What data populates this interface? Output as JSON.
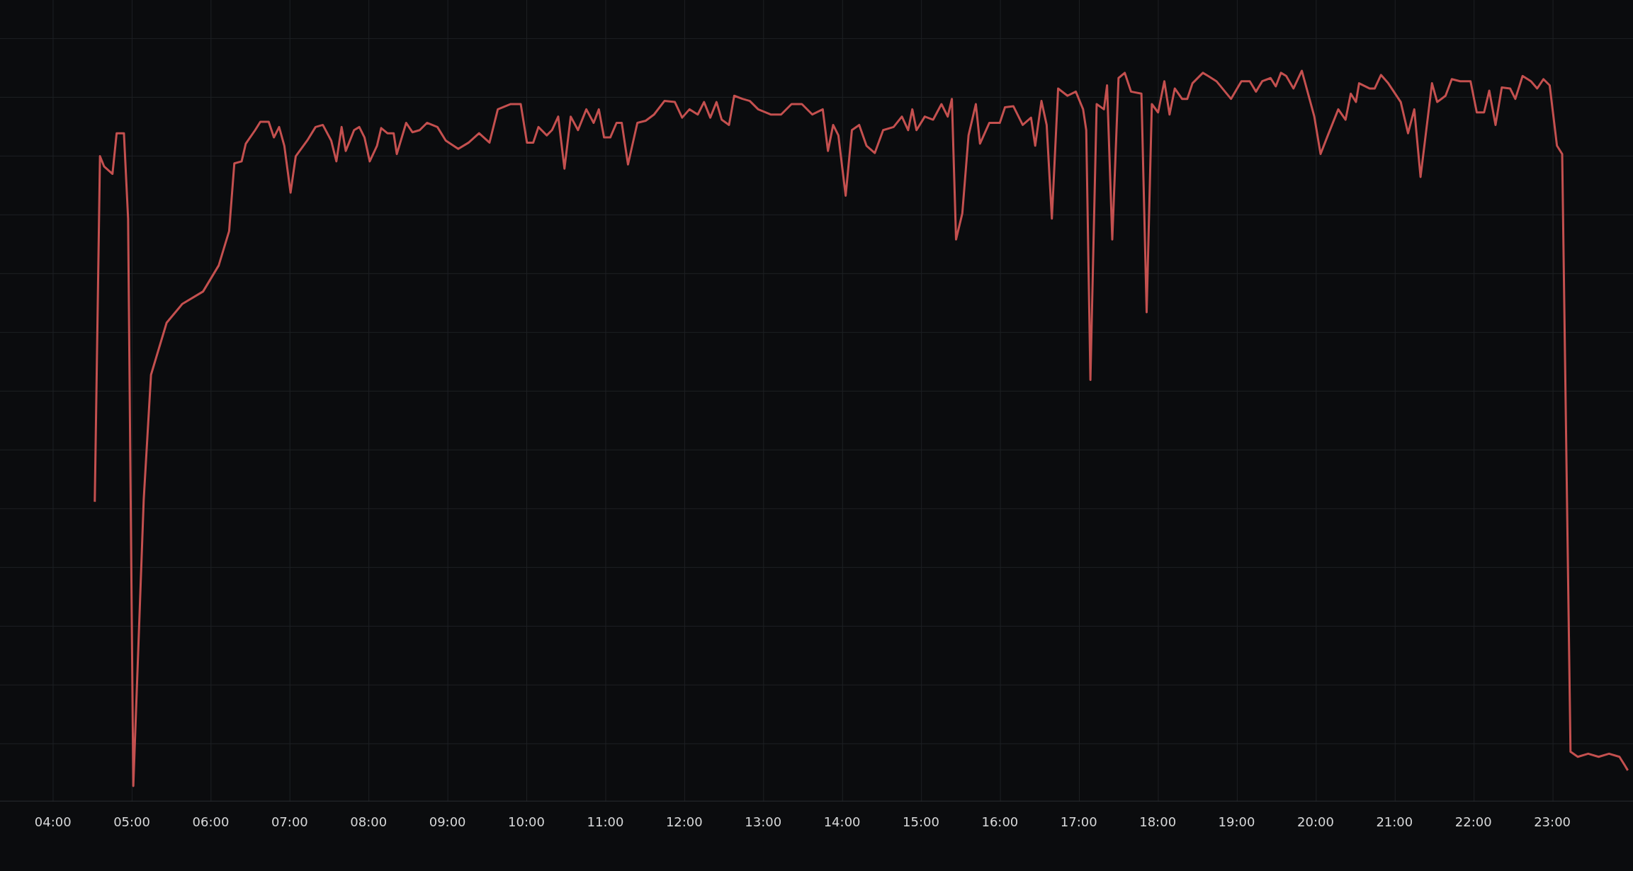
{
  "time_axis": {
    "labels": [
      "04:00",
      "05:00",
      "06:00",
      "07:00",
      "08:00",
      "09:00",
      "10:00",
      "11:00",
      "12:00",
      "13:00",
      "14:00",
      "15:00",
      "16:00",
      "17:00",
      "18:00",
      "19:00",
      "20:00",
      "21:00",
      "22:00",
      "23:00"
    ]
  }
}
